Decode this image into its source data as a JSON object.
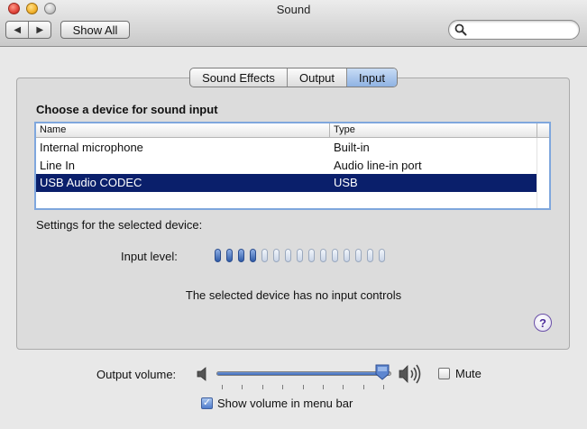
{
  "window": {
    "title": "Sound",
    "search_placeholder": "",
    "nav_back": "◀",
    "nav_forward": "▶",
    "show_all_label": "Show All"
  },
  "tabs": [
    {
      "label": "Sound Effects",
      "active": false
    },
    {
      "label": "Output",
      "active": false
    },
    {
      "label": "Input",
      "active": true
    }
  ],
  "input": {
    "choose_label": "Choose a device for sound input",
    "columns": [
      "Name",
      "Type"
    ],
    "devices": [
      {
        "name": "Internal microphone",
        "type": "Built-in",
        "selected": false
      },
      {
        "name": "Line In",
        "type": "Audio line-in port",
        "selected": false
      },
      {
        "name": "USB Audio CODEC",
        "type": "USB",
        "selected": true
      }
    ],
    "settings_label": "Settings for the selected device:",
    "input_level_label": "Input level:",
    "input_level_total_segments": 15,
    "input_level_active_segments": 4,
    "no_controls_text": "The selected device has no input controls",
    "help_label": "?"
  },
  "output": {
    "volume_label": "Output volume:",
    "volume_fraction": 0.95,
    "mute_label": "Mute",
    "mute_checked": false,
    "show_in_menubar_label": "Show volume in menu bar",
    "show_in_menubar_checked": true
  },
  "colors": {
    "selection": "#0a1f6b",
    "tab_active": "#8fb3e3",
    "help_accent": "#4d2d9b"
  }
}
